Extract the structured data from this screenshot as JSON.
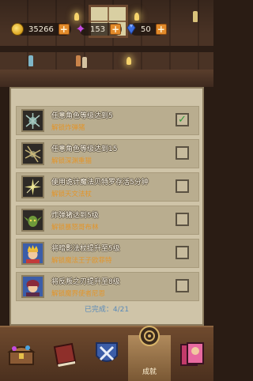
{
  "resources": {
    "coins": "35266",
    "stars": "153",
    "gems": "50",
    "coin_icon": "gold-coin-icon",
    "star_icon": "purple-star-icon",
    "gem_icon": "blue-gem-icon"
  },
  "tasks": [
    {
      "title": "任意角色等级达到5",
      "reward": "解锁炸弹猪",
      "completed": true
    },
    {
      "title": "任意角色等级达到15",
      "reward": "解锁深渊重猫",
      "completed": false
    },
    {
      "title": "使用诡计魔法贝特罗存活5分钟",
      "reward": "解锁天文法杖",
      "completed": false
    },
    {
      "title": "炸弹猪达到5级",
      "reward": "解锁暴怒哥布林",
      "completed": false
    },
    {
      "title": "将暗影法杖提升至5级",
      "reward": "解锁魔法王子欧菲特",
      "completed": false
    },
    {
      "title": "将反叛之刃提升至8级",
      "reward": "解锁魔界使者尼恩",
      "completed": false
    }
  ],
  "progress": "已完成：4/21",
  "nav": {
    "active_label": "成就"
  },
  "colors": {
    "reward_text": "#e2952b",
    "check_mark": "#2f9a3c",
    "progress_text": "#5a8ab8"
  }
}
